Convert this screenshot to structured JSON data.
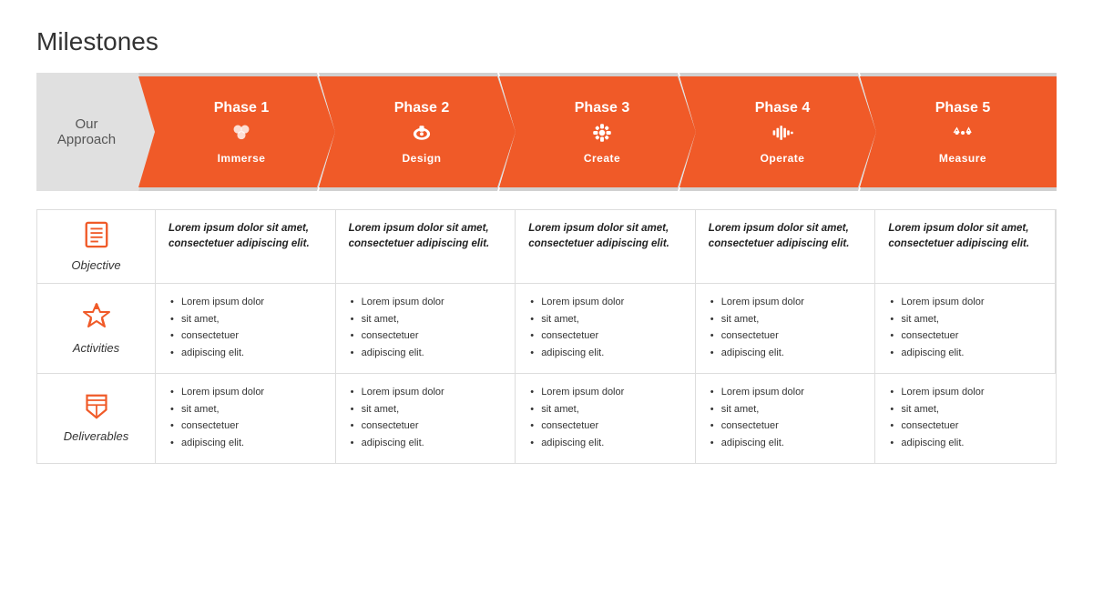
{
  "title": "Milestones",
  "approach": {
    "label": "Our\nApproach"
  },
  "phases": [
    {
      "id": 1,
      "label": "Phase 1",
      "name": "Immerse",
      "icon": "immerse"
    },
    {
      "id": 2,
      "label": "Phase 2",
      "name": "Design",
      "icon": "design"
    },
    {
      "id": 3,
      "label": "Phase 3",
      "name": "Create",
      "icon": "create"
    },
    {
      "id": 4,
      "label": "Phase 4",
      "name": "Operate",
      "icon": "operate"
    },
    {
      "id": 5,
      "label": "Phase 5",
      "name": "Measure",
      "icon": "measure"
    }
  ],
  "rows": {
    "objective": {
      "label": "Objective",
      "cells": [
        "Lorem ipsum dolor sit amet, consectetuer adipiscing elit.",
        "Lorem ipsum dolor sit amet, consectetuer adipiscing elit.",
        "Lorem ipsum dolor sit amet, consectetuer adipiscing elit.",
        "Lorem ipsum dolor sit amet, consectetuer adipiscing elit.",
        "Lorem ipsum dolor sit amet, consectetuer adipiscing elit."
      ]
    },
    "activities": {
      "label": "Activities",
      "cells": [
        [
          "Lorem ipsum dolor",
          "sit amet,",
          "consectetuer",
          "adipiscing elit."
        ],
        [
          "Lorem ipsum dolor",
          "sit amet,",
          "consectetuer",
          "adipiscing elit."
        ],
        [
          "Lorem ipsum dolor",
          "sit amet,",
          "consectetuer",
          "adipiscing elit."
        ],
        [
          "Lorem ipsum dolor",
          "sit amet,",
          "consectetuer",
          "adipiscing elit."
        ],
        [
          "Lorem ipsum dolor",
          "sit amet,",
          "consectetuer",
          "adipiscing elit."
        ]
      ]
    },
    "deliverables": {
      "label": "Deliverables",
      "cells": [
        [
          "Lorem ipsum dolor",
          "sit amet,",
          "consectetuer",
          "adipiscing elit."
        ],
        [
          "Lorem ipsum dolor",
          "sit amet,",
          "consectetuer",
          "adipiscing elit."
        ],
        [
          "Lorem ipsum dolor",
          "sit amet,",
          "consectetuer",
          "adipiscing elit."
        ],
        [
          "Lorem ipsum dolor",
          "sit amet,",
          "consectetuer",
          "adipiscing elit."
        ],
        [
          "Lorem ipsum dolor",
          "sit amet,",
          "consectetuer",
          "adipiscing elit."
        ]
      ]
    }
  },
  "colors": {
    "orange": "#F05A28",
    "gray": "#d0d0d0",
    "dark": "#555"
  }
}
